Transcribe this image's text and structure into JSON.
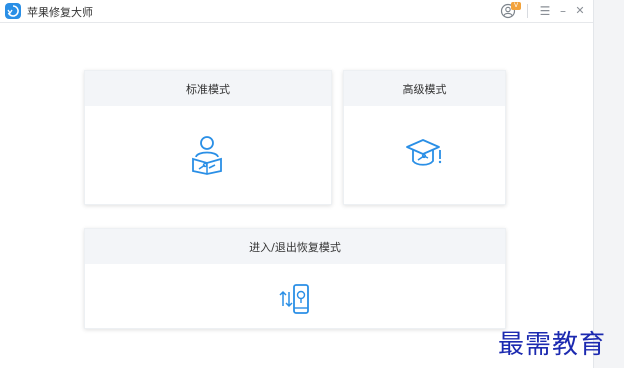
{
  "app": {
    "title": "苹果修复大师",
    "vip": "V"
  },
  "titlebar": {
    "menu_glyph": "☰",
    "min_glyph": "–",
    "close_glyph": "✕"
  },
  "cards": {
    "standard": {
      "label": "标准模式",
      "icon": "person-with-wrench-icon"
    },
    "advanced": {
      "label": "高级模式",
      "icon": "graduation-cap-icon"
    },
    "recovery": {
      "label": "进入/退出恢复模式",
      "icon": "phone-transfer-icon"
    }
  },
  "watermark": "最需教育",
  "colors": {
    "accent": "#2a8fe6",
    "vip": "#f2a23b",
    "watermark": "#1c2ab0"
  }
}
